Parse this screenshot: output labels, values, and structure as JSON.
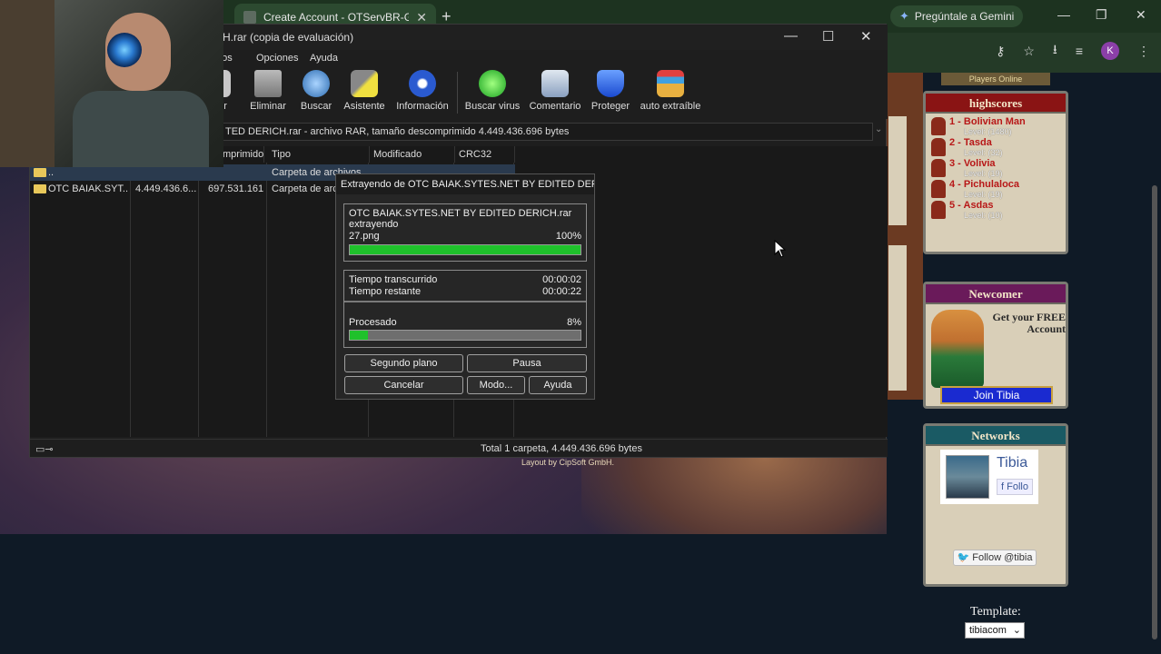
{
  "browser": {
    "tab_title": "Create Account - OTServBR-Glo",
    "gemini_label": "Pregúntale a Gemini",
    "avatar_letter": "K"
  },
  "page": {
    "layout_credit": "Layout by CipSoft GmbH.",
    "players_online": "Players Online",
    "highscores_title": "highscores",
    "highscores": [
      {
        "rank": "1",
        "name": "Bolivian Man",
        "level": "Level: (1480)"
      },
      {
        "rank": "2",
        "name": "Tasda",
        "level": "Level: (32)"
      },
      {
        "rank": "3",
        "name": "Volivia",
        "level": "Level: (19)"
      },
      {
        "rank": "4",
        "name": "Pichulaloca",
        "level": "Level: (19)"
      },
      {
        "rank": "5",
        "name": "Asdas",
        "level": "Level: (10)"
      }
    ],
    "newcomer_title": "Newcomer",
    "newcomer_text": "Get your FREE Account",
    "join_button": "Join Tibia",
    "networks_title": "Networks",
    "fb_name": "Tibia",
    "fb_follow": "Follo",
    "tw_follow": "Follow @tibia",
    "template_label": "Template:",
    "template_value": "tibiacom"
  },
  "winrar": {
    "title": "ICH.rar (copia de evaluación)",
    "menu": [
      "ritos",
      "Opciones",
      "Ayuda"
    ],
    "toolbar": [
      "er",
      "Eliminar",
      "Buscar",
      "Asistente",
      "Información",
      "Buscar virus",
      "Comentario",
      "Proteger",
      "auto extraíble"
    ],
    "address": "TED DERICH.rar - archivo RAR, tamaño descomprimido 4.449.436.696 bytes",
    "columns": [
      "mprimido",
      "Tipo",
      "Modificado",
      "CRC32"
    ],
    "rows": [
      {
        "name": "..",
        "size": "",
        "packed": "",
        "type": "Carpeta de archivos"
      },
      {
        "name": "OTC BAIAK.SYT...",
        "size": "4.449.436.6...",
        "packed": "697.531.161",
        "type": "Carpeta de arc"
      }
    ],
    "status": "Total 1 carpeta, 4.449.436.696 bytes"
  },
  "dialog": {
    "title": "Extrayendo de OTC BAIAK.SYTES.NET BY EDITED DERICH.rar",
    "archive": "OTC BAIAK.SYTES.NET BY EDITED DERICH.rar",
    "action": "extrayendo",
    "file": "27.png",
    "file_percent": "100%",
    "file_progress": 1.0,
    "elapsed_label": "Tiempo transcurrido",
    "elapsed_value": "00:00:02",
    "remaining_label": "Tiempo restante",
    "remaining_value": "00:00:22",
    "processed_label": "Procesado",
    "processed_percent": "8%",
    "processed_progress": 0.08,
    "buttons": {
      "background": "Segundo plano",
      "pause": "Pausa",
      "cancel": "Cancelar",
      "mode": "Modo...",
      "help": "Ayuda"
    }
  },
  "colors": {
    "progress_green": "#1fc12b",
    "highscore_name": "#b81818"
  }
}
